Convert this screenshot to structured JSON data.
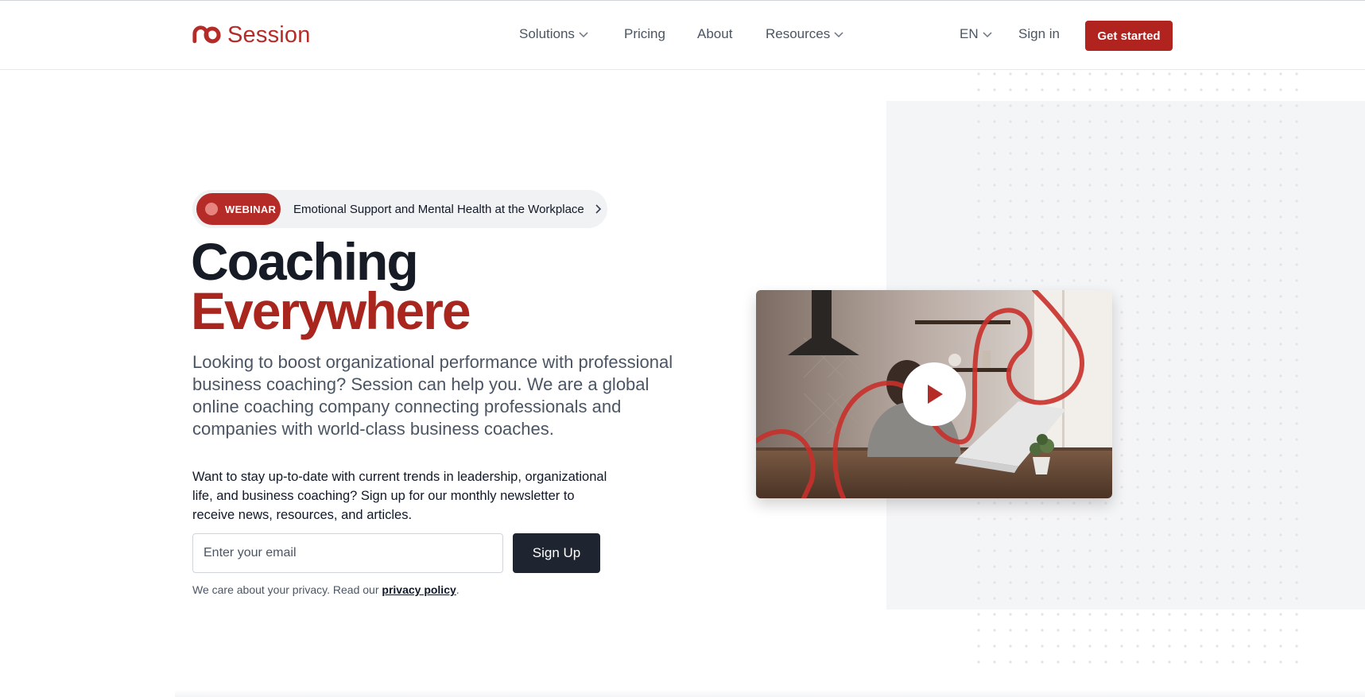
{
  "header": {
    "logo_text": "Session",
    "nav": [
      {
        "label": "Solutions",
        "has_dropdown": true
      },
      {
        "label": "Pricing",
        "has_dropdown": false
      },
      {
        "label": "About",
        "has_dropdown": false
      },
      {
        "label": "Resources",
        "has_dropdown": true
      }
    ],
    "language": "EN",
    "sign_in": "Sign in",
    "cta": "Get started"
  },
  "hero": {
    "webinar_tag": "WEBINAR",
    "webinar_title": "Emotional Support and Mental Health at the Workplace",
    "heading_line1": "Coaching",
    "heading_line2": "Everywhere",
    "lead": "Looking to boost organizational performance with professional business coaching? Session can help you. We are a global online coaching company connecting professionals and companies with world-class business coaches.",
    "newsletter_text": "Want to stay up-to-date with current trends in leadership, organizational life, and business coaching? Sign up for our monthly newsletter to receive news, resources, and articles.",
    "email_placeholder": "Enter your email",
    "signup_button": "Sign Up",
    "privacy_prefix": "We care about your privacy. Read our ",
    "privacy_link": "privacy policy",
    "privacy_suffix": "."
  },
  "video": {
    "play_icon": "play-icon"
  },
  "colors": {
    "brand": "#b0231f",
    "heading_dark": "#161b26",
    "heading_accent": "#a9261f",
    "button_dark": "#1f2530"
  }
}
